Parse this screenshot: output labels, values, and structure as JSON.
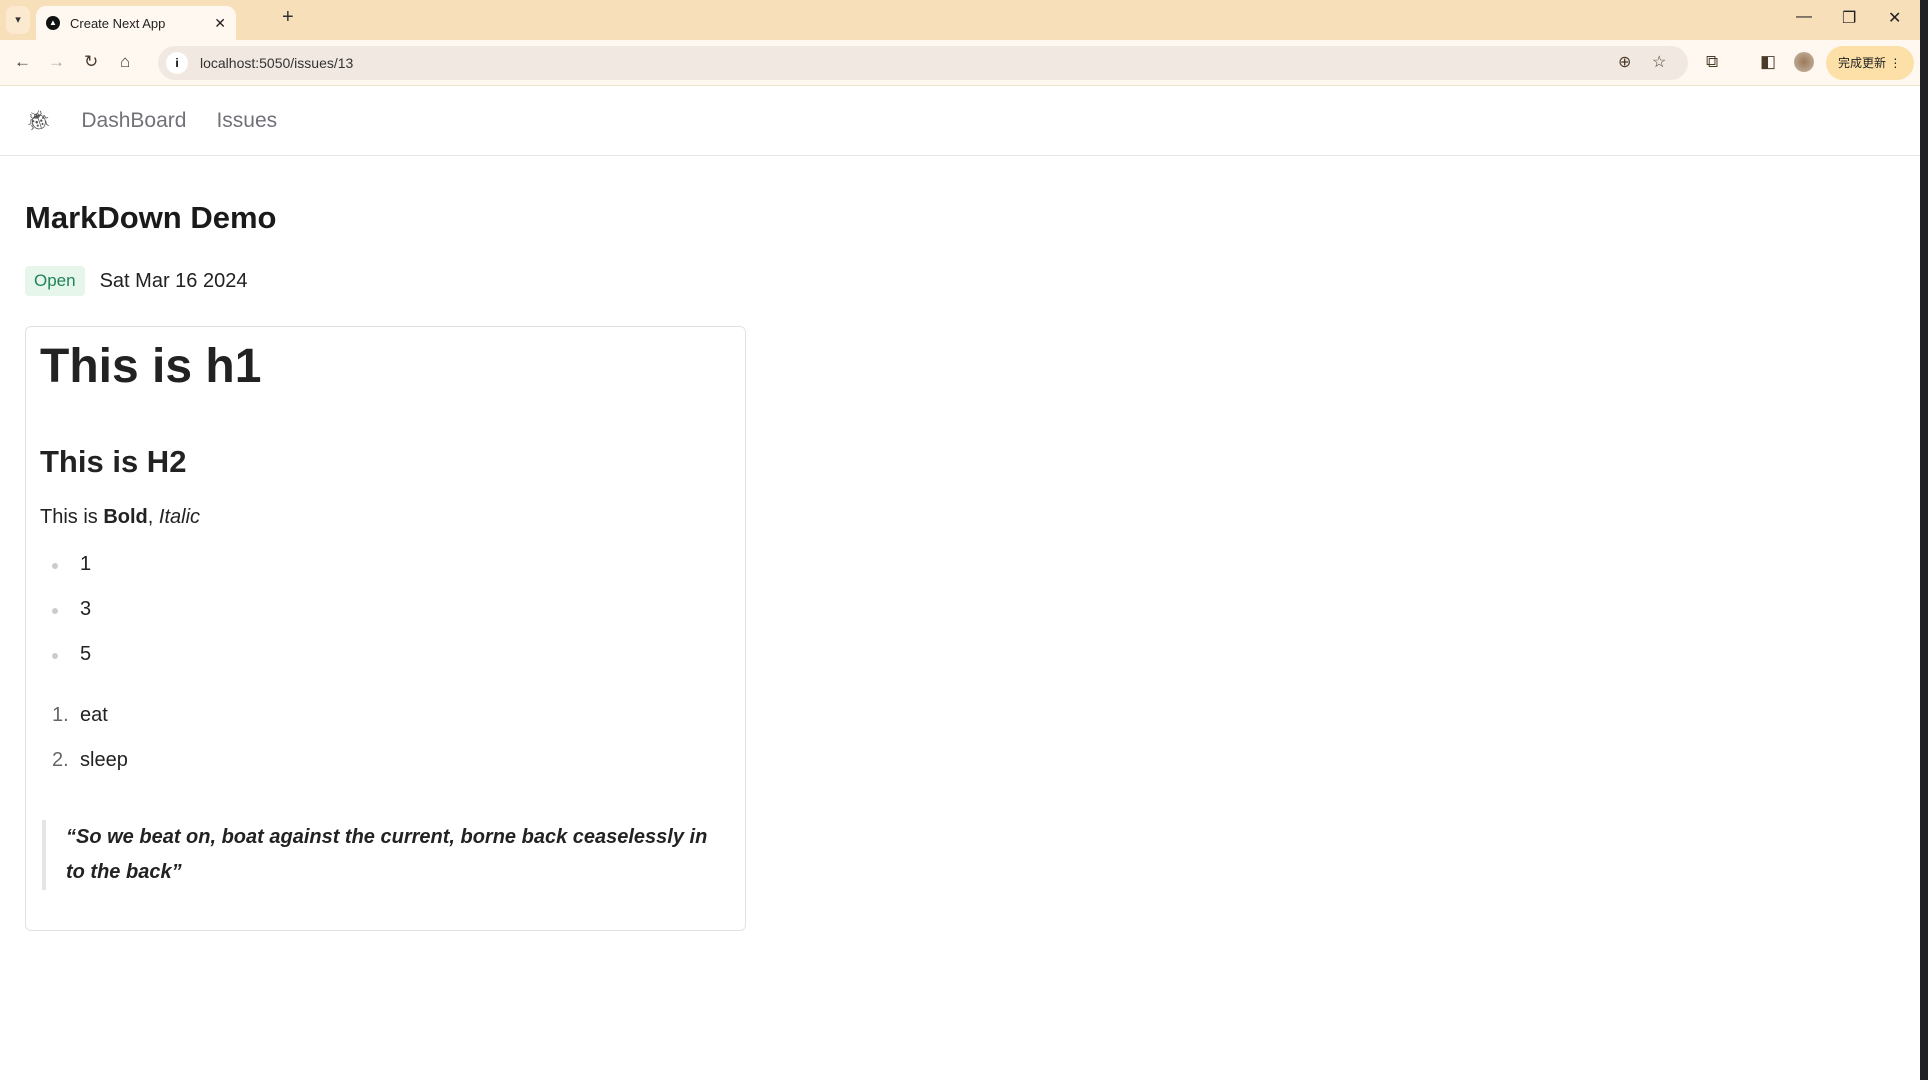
{
  "browser": {
    "tab_title": "Create Next App",
    "url": "localhost:5050/issues/13",
    "update_label": "完成更新"
  },
  "nav": {
    "links": [
      "DashBoard",
      "Issues"
    ]
  },
  "issue": {
    "title": "MarkDown Demo",
    "status": "Open",
    "date": "Sat Mar 16 2024",
    "h1": "This is h1",
    "h2": "This is H2",
    "para": {
      "prefix": "This is ",
      "bold": "Bold",
      "sep": ", ",
      "italic": "Italic"
    },
    "bullets": [
      "1",
      "3",
      "5"
    ],
    "ordered": [
      {
        "n": "1.",
        "t": "eat"
      },
      {
        "n": "2.",
        "t": "sleep"
      }
    ],
    "quote": "“So we beat on, boat against the current, borne back ceaselessly in to the back”"
  },
  "colors": {
    "badge_bg": "#e6f6eb",
    "badge_text": "#218358",
    "tabbar": "#f7dfba"
  }
}
